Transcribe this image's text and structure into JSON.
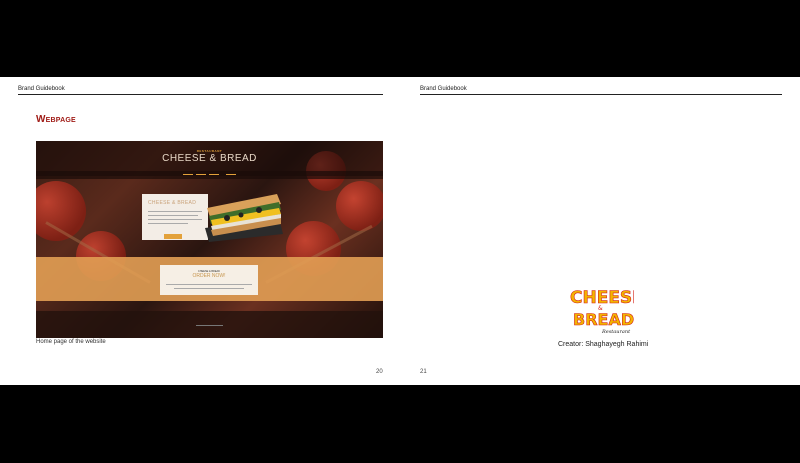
{
  "left_page": {
    "header": "Brand Guidebook",
    "section_title": "Webpage",
    "screenshot": {
      "brand_small": "RESTAURANT",
      "brand_big": "CHEESE & BREAD",
      "card_title": "CHEESE & BREAD",
      "order_label": "CHEESE & BREAD",
      "order_title": "ORDER NOW!"
    },
    "caption": "Home page of the website",
    "page_number": "20"
  },
  "right_page": {
    "header": "Brand Guidebook",
    "logo": {
      "line1": "CHEESE",
      "amp": "&",
      "line2": "BREAD",
      "sub": "Restaurant"
    },
    "creator": "Creator: Shaghayegh Rahimi",
    "page_number": "21"
  },
  "colors": {
    "accent": "#a01c17",
    "logo_yellow": "#f3b400",
    "logo_red": "#d4201a",
    "background": "#000000"
  }
}
